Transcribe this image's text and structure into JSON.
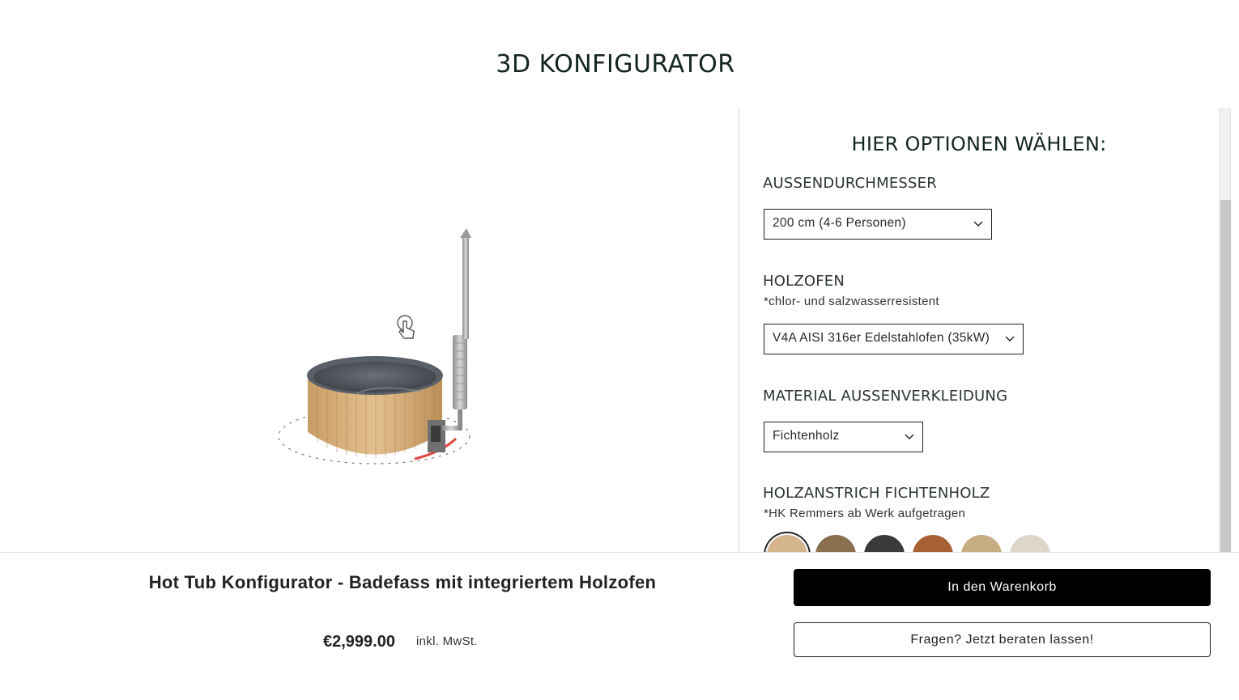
{
  "header": {
    "title": "3D KONFIGURATOR"
  },
  "viewer": {
    "rotate_hint_icon": "hand-pointer-icon",
    "model": "hot-tub-with-wood-stove"
  },
  "options": {
    "title": "HIER OPTIONEN WÄHLEN:",
    "diameter": {
      "label": "AUSSENDURCHMESSER",
      "value": "200 cm (4-6 Personen)"
    },
    "stove": {
      "label": "HOLZOFEN",
      "note": "*chlor- und salzwasserresistent",
      "value": "V4A AISI 316er Edelstahlofen (35kW)"
    },
    "cladding": {
      "label": "MATERIAL AUSSENVERKLEIDUNG",
      "value": "Fichtenholz"
    },
    "finish": {
      "label": "HOLZANSTRICH FICHTENHOLZ",
      "note": "*HK Remmers ab Werk aufgetragen",
      "swatches": [
        "#d4b48a",
        "#8a6e50",
        "#3a3a3a",
        "#a85f33",
        "#c8ad82",
        "#ddd6cb"
      ],
      "selected_index": 0
    }
  },
  "product": {
    "title": "Hot Tub Konfigurator - Badefass mit integriertem Holzofen",
    "price": "€2,999.00",
    "tax_note": "inkl. MwSt."
  },
  "actions": {
    "add_to_cart": "In den Warenkorb",
    "consult": "Fragen? Jetzt beraten lassen!"
  }
}
